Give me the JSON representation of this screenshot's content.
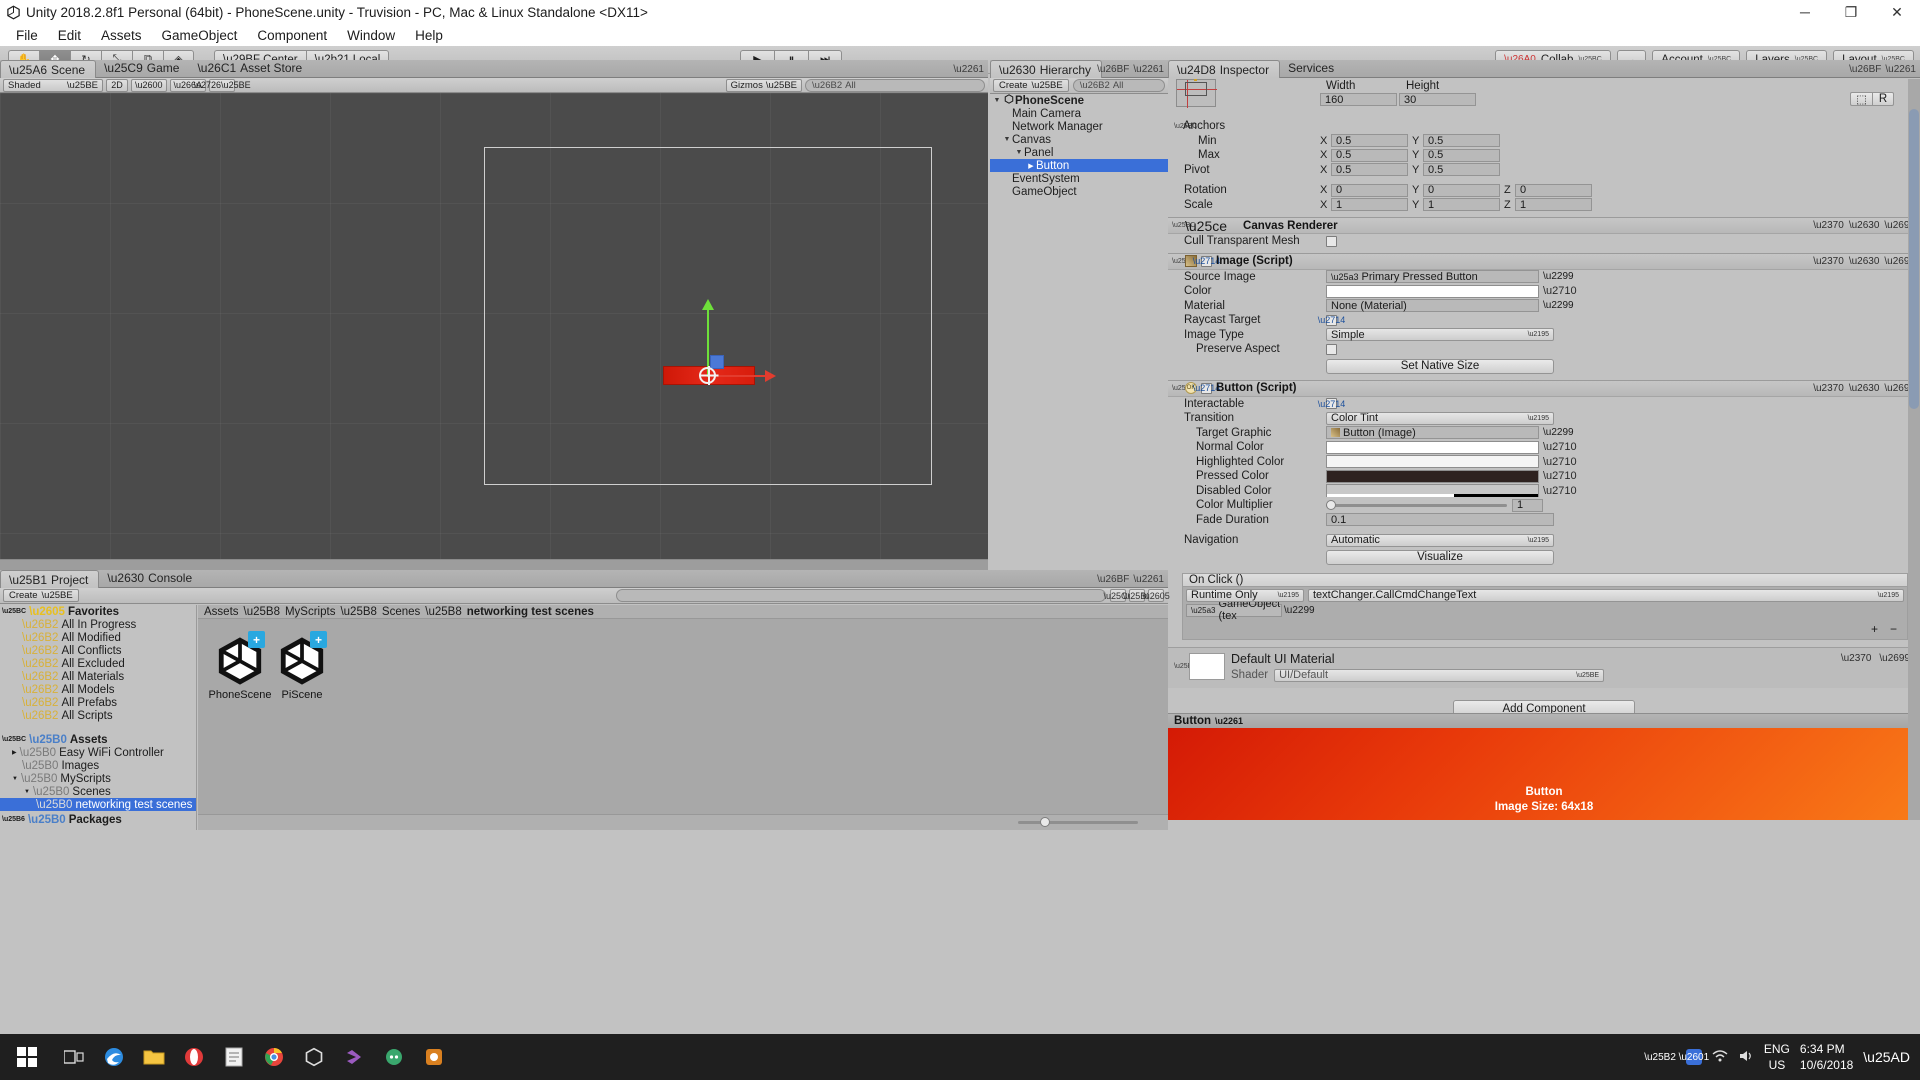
{
  "window": {
    "title": "Unity 2018.2.8f1 Personal (64bit) - PhoneScene.unity - Truvision - PC, Mac & Linux Standalone <DX11>",
    "minimize": "─",
    "maximize": "❐",
    "close": "✕"
  },
  "menu": [
    "File",
    "Edit",
    "Assets",
    "GameObject",
    "Component",
    "Window",
    "Help"
  ],
  "toolbar": {
    "tools": [
      "✋",
      "✥",
      "↻",
      "⤡",
      "⧉",
      "◈"
    ],
    "pivot": "Center",
    "space": "Local",
    "play": "▶",
    "pause": "⏸",
    "step": "⏭",
    "collab": "Collab",
    "cloud": "☁",
    "account": "Account",
    "layers": "Layers",
    "layout": "Layout"
  },
  "scene": {
    "tabs": [
      {
        "label": "Scene",
        "icon": "scene-icon",
        "active": true
      },
      {
        "label": "Game",
        "icon": "game-icon",
        "active": false
      },
      {
        "label": "Asset Store",
        "icon": "store-icon",
        "active": false
      }
    ],
    "shading": "Shaded",
    "mode2d": "2D",
    "gizmos": "Gizmos",
    "search_placeholder": "All"
  },
  "hierarchy": {
    "tab": "Hierarchy",
    "create": "Create",
    "search_placeholder": "All",
    "items": [
      {
        "label": "PhoneScene",
        "depth": 0,
        "arrow": "▼",
        "scene": true,
        "selected": false
      },
      {
        "label": "Main Camera",
        "depth": 1,
        "arrow": "",
        "scene": false,
        "selected": false
      },
      {
        "label": "Network Manager",
        "depth": 1,
        "arrow": "",
        "scene": false,
        "selected": false
      },
      {
        "label": "Canvas",
        "depth": 1,
        "arrow": "▼",
        "scene": false,
        "selected": false
      },
      {
        "label": "Panel",
        "depth": 2,
        "arrow": "▼",
        "scene": false,
        "selected": false
      },
      {
        "label": "Button",
        "depth": 3,
        "arrow": "▶",
        "scene": false,
        "selected": true
      },
      {
        "label": "EventSystem",
        "depth": 1,
        "arrow": "",
        "scene": false,
        "selected": false
      },
      {
        "label": "GameObject",
        "depth": 1,
        "arrow": "",
        "scene": false,
        "selected": false
      }
    ]
  },
  "inspector": {
    "tabs": [
      {
        "label": "Inspector",
        "active": true
      },
      {
        "label": "Services",
        "active": false
      }
    ],
    "rect_transform": {
      "width_label": "Width",
      "height_label": "Height",
      "width": "160",
      "height": "30",
      "blueprint_btn": "⬚",
      "raw_btn": "R",
      "anchors_label": "Anchors",
      "min_label": "Min",
      "max_label": "Max",
      "pivot_label": "Pivot",
      "rotation_label": "Rotation",
      "scale_label": "Scale",
      "min_x": "0.5",
      "min_y": "0.5",
      "max_x": "0.5",
      "max_y": "0.5",
      "pivot_x": "0.5",
      "pivot_y": "0.5",
      "rot_x": "0",
      "rot_y": "0",
      "rot_z": "0",
      "scale_x": "1",
      "scale_y": "1",
      "scale_z": "1"
    },
    "canvas_renderer": {
      "title": "Canvas Renderer",
      "cull_label": "Cull Transparent Mesh",
      "cull_checked": false
    },
    "image_script": {
      "title": "Image (Script)",
      "enabled": true,
      "source_image_label": "Source Image",
      "source_image_value": "Primary Pressed Button",
      "color_label": "Color",
      "color_value": "#FFFFFF",
      "material_label": "Material",
      "material_value": "None (Material)",
      "raycast_label": "Raycast Target",
      "raycast_checked": true,
      "image_type_label": "Image Type",
      "image_type_value": "Simple",
      "preserve_label": "Preserve Aspect",
      "preserve_checked": false,
      "native_size_btn": "Set Native Size"
    },
    "button_script": {
      "title": "Button (Script)",
      "enabled": true,
      "interactable_label": "Interactable",
      "interactable_checked": true,
      "transition_label": "Transition",
      "transition_value": "Color Tint",
      "target_graphic_label": "Target Graphic",
      "target_graphic_value": "Button (Image)",
      "normal_color_label": "Normal Color",
      "normal_color_value": "#FFFFFF",
      "highlighted_color_label": "Highlighted Color",
      "highlighted_color_value": "#F5F5F5",
      "pressed_color_label": "Pressed Color",
      "pressed_color_value": "#2E2220",
      "disabled_color_label": "Disabled Color",
      "disabled_color_value": "#C8C8C8",
      "color_multiplier_label": "Color Multiplier",
      "color_multiplier_value": "1",
      "fade_duration_label": "Fade Duration",
      "fade_duration_value": "0.1",
      "navigation_label": "Navigation",
      "navigation_value": "Automatic",
      "visualize_btn": "Visualize"
    },
    "on_click": {
      "header": "On Click ()",
      "runtime_value": "Runtime Only",
      "function_value": "textChanger.CallCmdChangeText",
      "object_value": "GameObject (tex",
      "add_btn": "+",
      "remove_btn": "−"
    },
    "material": {
      "name": "Default UI Material",
      "shader_label": "Shader",
      "shader_value": "UI/Default"
    },
    "add_component_btn": "Add Component",
    "preview": {
      "title": "Button",
      "label_line1": "Button",
      "label_line2": "Image Size: 64x18"
    }
  },
  "project": {
    "tabs": [
      {
        "label": "Project",
        "active": true
      },
      {
        "label": "Console",
        "active": false
      }
    ],
    "create": "Create",
    "favorites_label": "Favorites",
    "favorites": [
      "All In Progress",
      "All Modified",
      "All Conflicts",
      "All Excluded",
      "All Materials",
      "All Models",
      "All Prefabs",
      "All Scripts"
    ],
    "assets_label": "Assets",
    "tree": [
      {
        "label": "Easy WiFi Controller",
        "depth": 1,
        "arrow": "▶",
        "selected": false
      },
      {
        "label": "Images",
        "depth": 1,
        "arrow": "",
        "selected": false
      },
      {
        "label": "MyScripts",
        "depth": 1,
        "arrow": "▼",
        "selected": false
      },
      {
        "label": "Scenes",
        "depth": 2,
        "arrow": "▼",
        "selected": false
      },
      {
        "label": "networking test scenes",
        "depth": 3,
        "arrow": "",
        "selected": true
      }
    ],
    "packages_label": "Packages",
    "breadcrumb": [
      "Assets",
      "MyScripts",
      "Scenes",
      "networking test scenes"
    ],
    "assets": [
      {
        "name": "PhoneScene",
        "badge": "+"
      },
      {
        "name": "PiScene",
        "badge": "+"
      }
    ]
  },
  "taskbar": {
    "start": "⊞",
    "icons": [
      "task-view-icon",
      "edge-icon",
      "explorer-icon",
      "opera-icon",
      "notepad-icon",
      "chrome-icon",
      "unity-icon",
      "vs-icon",
      "discord-icon",
      "app-icon"
    ],
    "tray": {
      "up_arrow": "▲",
      "lang_line1": "ENG",
      "lang_line2": "US",
      "time": "6:34 PM",
      "date": "10/6/2018",
      "notification": "▭"
    }
  },
  "colors": {
    "accent": "#3a6fd8",
    "panel": "#c2c2c2",
    "scene_bg": "#4b4b4b"
  }
}
